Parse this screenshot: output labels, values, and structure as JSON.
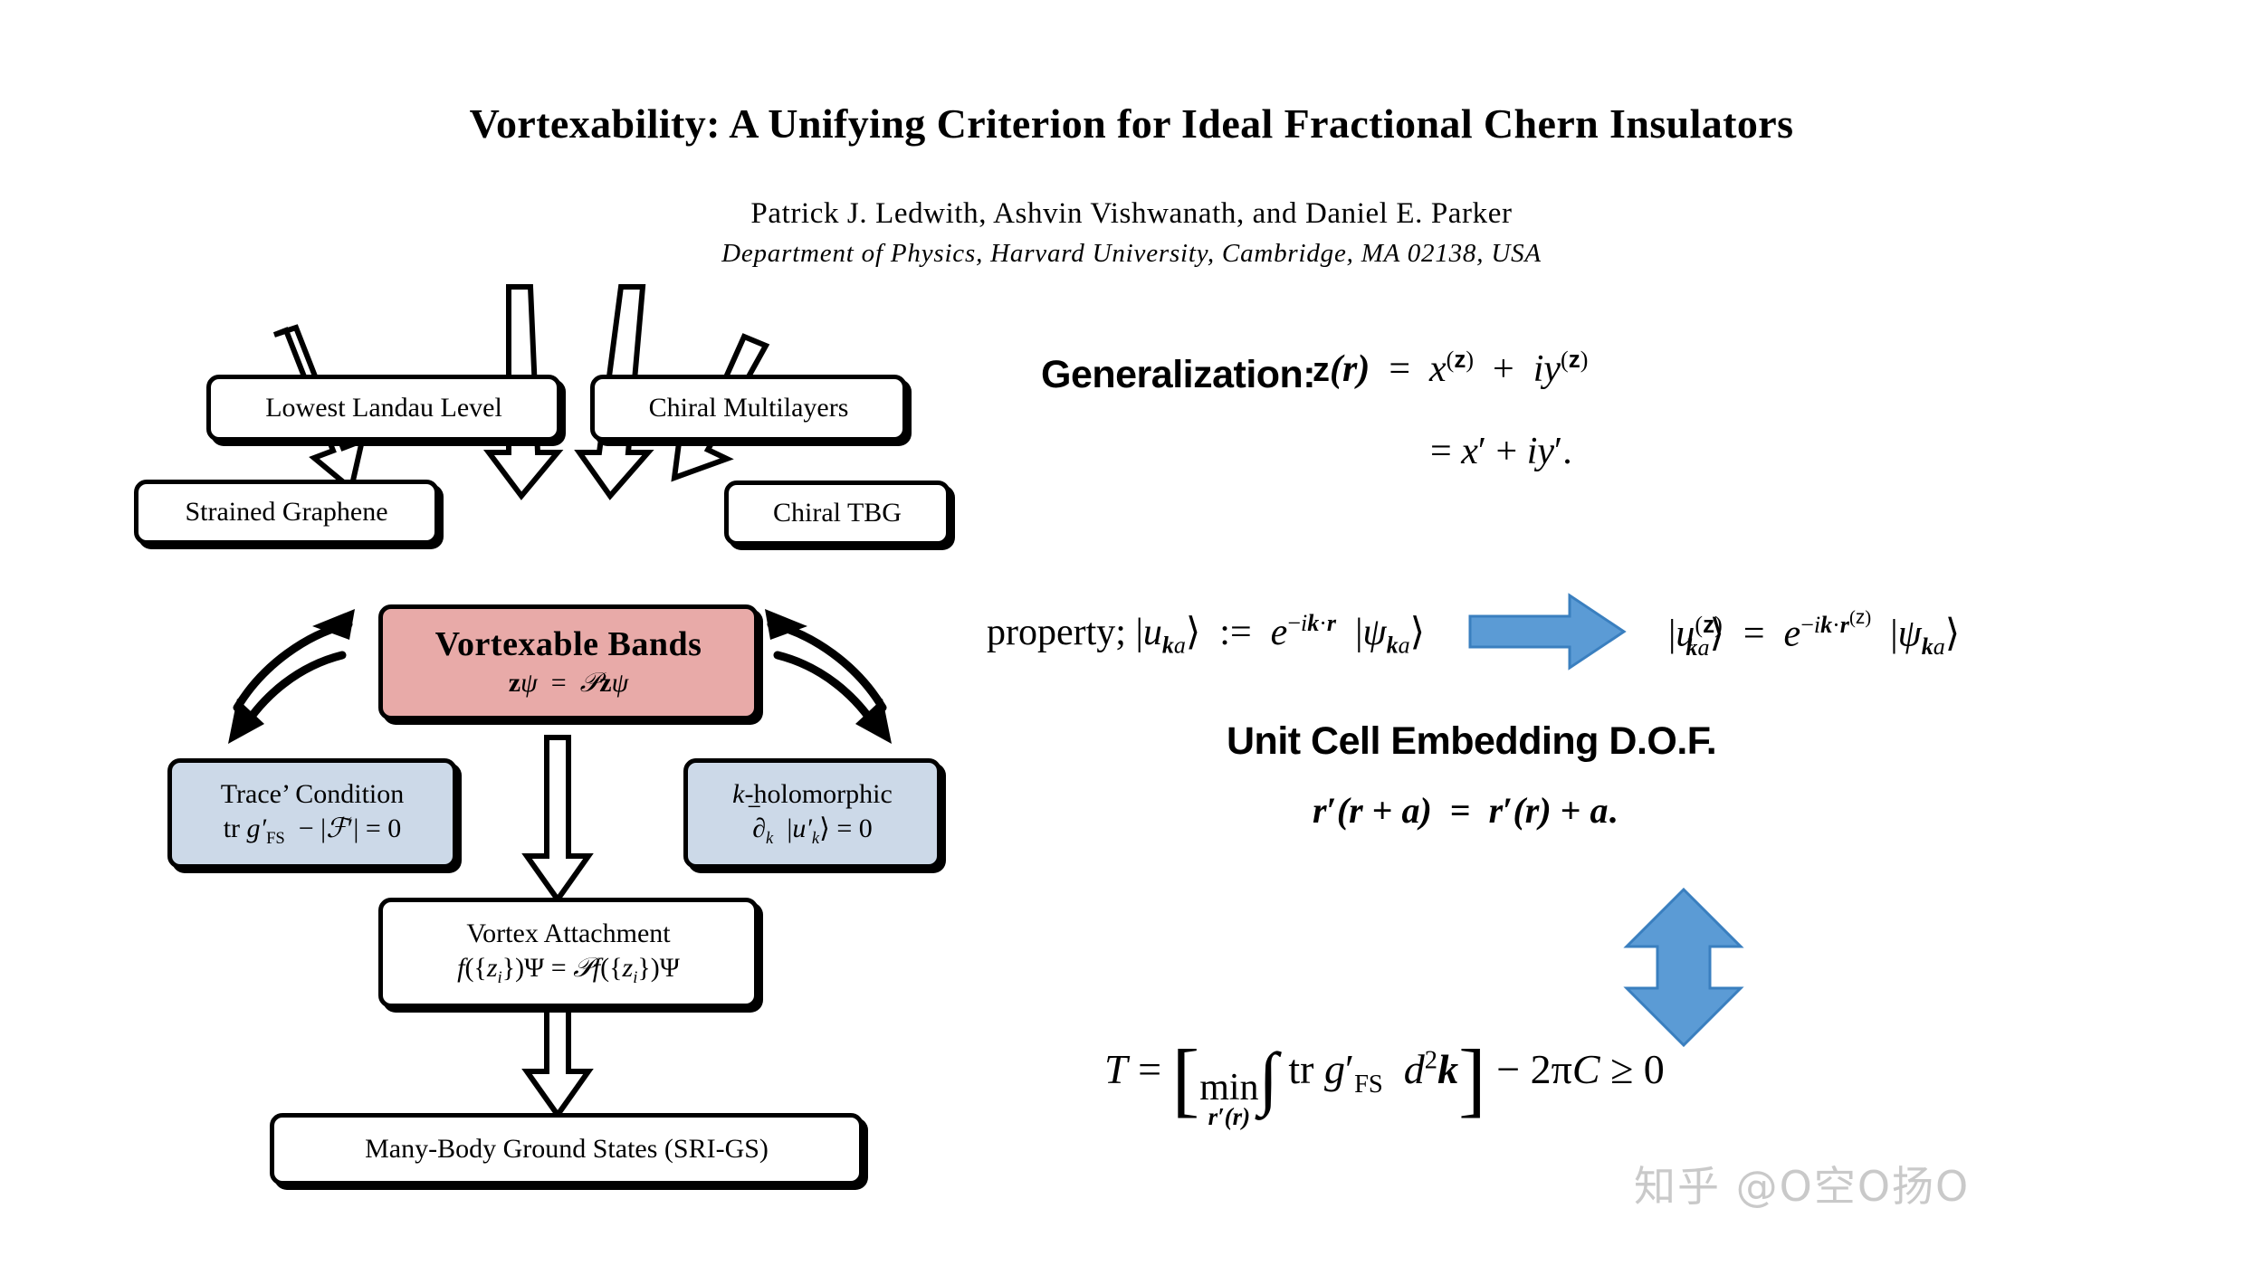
{
  "header": {
    "title": "Vortexability: A Unifying Criterion for Ideal Fractional Chern Insulators",
    "authors": "Patrick J. Ledwith, Ashvin Vishwanath, and Daniel E. Parker",
    "affiliation": "Department of Physics, Harvard University, Cambridge, MA 02138, USA"
  },
  "colors": {
    "pink_box": "#e8aaa8",
    "blue_box": "#ccd9e8",
    "blue_arrow": "#5b9bd5",
    "blue_arrow_border": "#3a7fbf",
    "outline": "#000000",
    "watermark": "#c9c9c9",
    "background": "#ffffff"
  },
  "flowchart": {
    "sources": [
      {
        "id": "lowest-landau-level",
        "label": "Lowest Landau Level"
      },
      {
        "id": "chiral-multilayers",
        "label": "Chiral Multilayers"
      },
      {
        "id": "strained-graphene",
        "label": "Strained Graphene"
      },
      {
        "id": "chiral-tbg",
        "label": "Chiral TBG"
      }
    ],
    "central": {
      "id": "vortexable-bands",
      "label": "Vortexable Bands",
      "formula": "zψ = 𝒫zψ"
    },
    "conditions": [
      {
        "id": "trace-condition",
        "label": "Trace’ Condition",
        "formula": "tr g′FS − |ℱ′| = 0"
      },
      {
        "id": "k-holomorphic",
        "label": "k-holomorphic",
        "formula": "∂̄k |u′k⟩ = 0"
      }
    ],
    "vortex_attachment": {
      "id": "vortex-attachment",
      "label": "Vortex Attachment",
      "formula": "f({zi})Ψ = 𝒫f({zi})Ψ"
    },
    "ground_states": {
      "id": "many-body-ground-states",
      "label": "Many-Body Ground States (SRI-GS)"
    }
  },
  "right_panel": {
    "generalization_label": "Generalization:",
    "generalization_eq_line1": "z(r) = x(z) + iy(z)",
    "generalization_eq_line2": "= x′ + iy′.",
    "bloch_eq_left": "|uka⟩ := e−ik·r |ψka⟩",
    "bloch_eq_right": "|u(z)ka⟩ = e−ik·r(z) |ψka⟩",
    "unit_cell_heading": "Unit Cell Embedding D.O.F.",
    "unit_cell_eq": "r′(r + a) = r′(r) + a.",
    "trace_bound_eq": "T = [ minr′(r) ∫ tr g′FS d²k ] − 2πC ≥ 0"
  },
  "watermark": {
    "text": "知乎 @O空O扬O"
  }
}
